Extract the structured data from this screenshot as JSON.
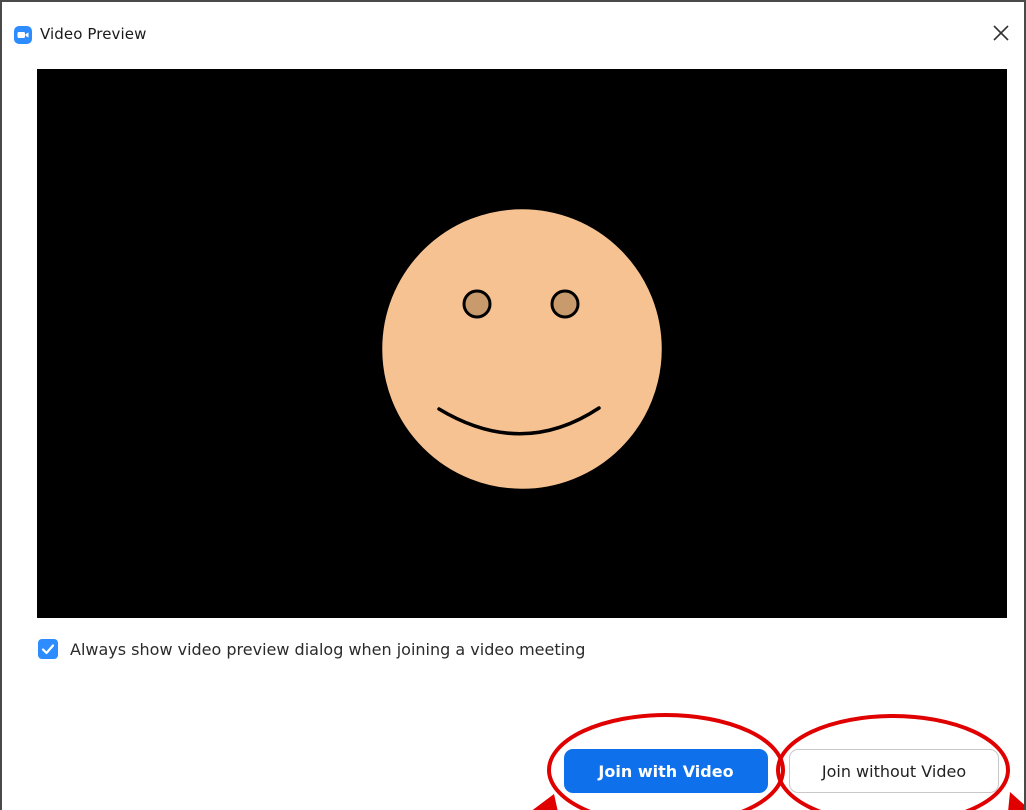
{
  "window": {
    "title": "Video Preview",
    "app_icon": "zoom-camera-icon",
    "close_icon": "close-icon"
  },
  "preview": {
    "background_color": "#000000",
    "avatar": {
      "icon": "smiley-face-icon",
      "face_color": "#f7c292",
      "eye_color": "#c89a6c"
    }
  },
  "checkbox": {
    "checked": true,
    "label": "Always show video preview dialog when joining a video meeting"
  },
  "buttons": {
    "join_with_video": "Join with Video",
    "join_without_video": "Join without Video"
  },
  "colors": {
    "accent": "#0e71eb",
    "annotation": "#e00000"
  }
}
